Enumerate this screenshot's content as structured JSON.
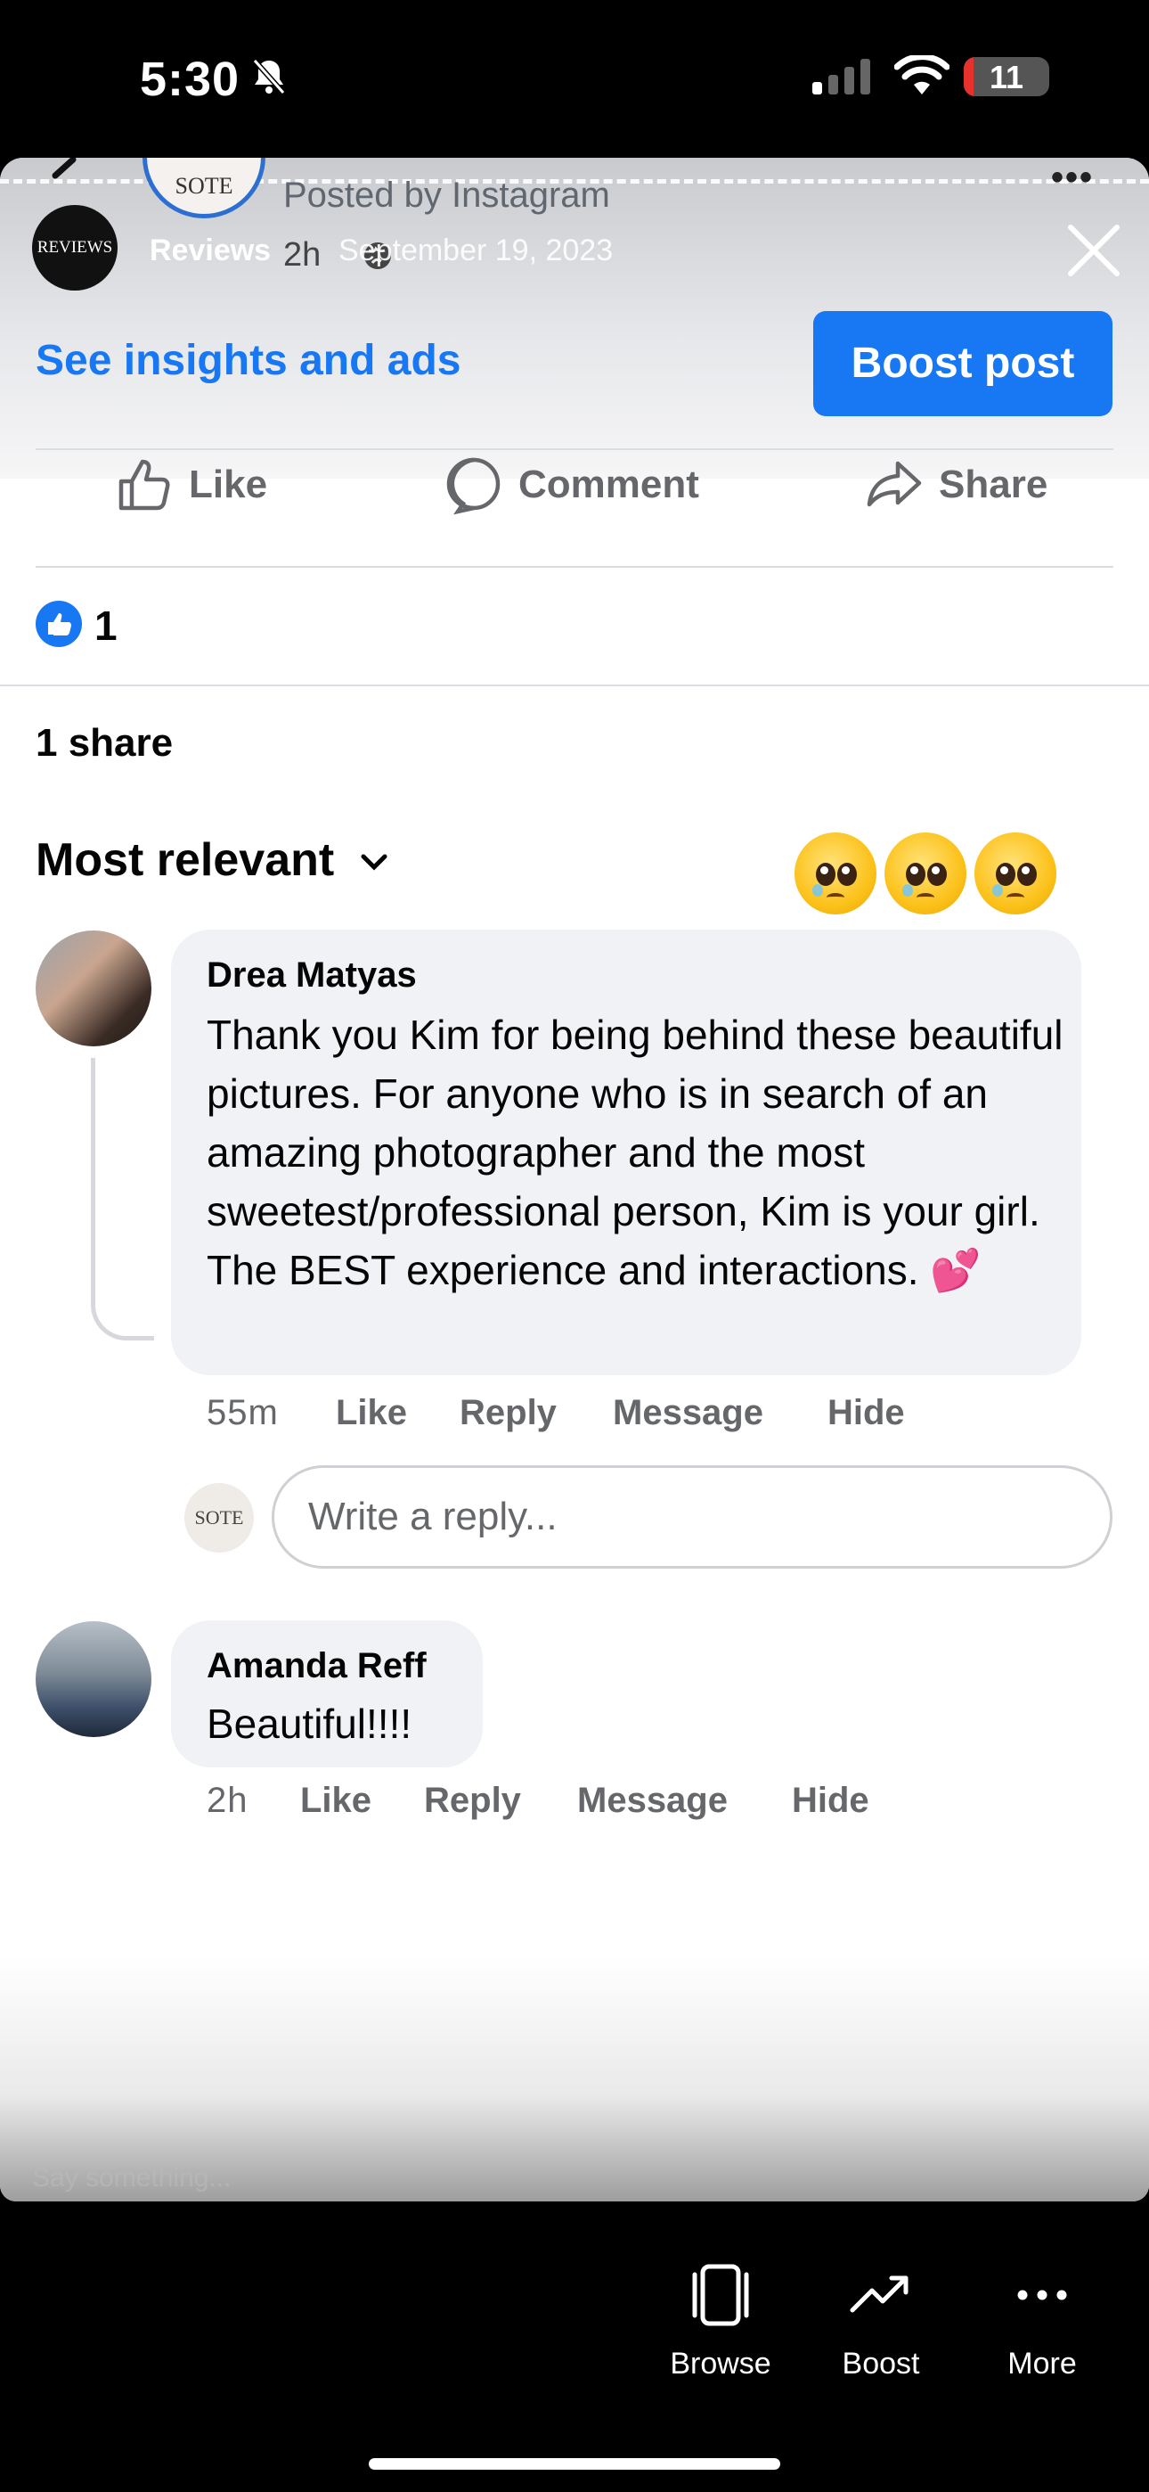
{
  "status_bar": {
    "time": "5:30",
    "battery": "11",
    "battery_percent": 11
  },
  "post_header": {
    "posted_by": "Posted by Instagram",
    "page_logo_text": "SOTE",
    "reviews_logo_text": "REVIEWS",
    "reviews_title": "Reviews",
    "date": "September 19, 2023",
    "time_ago": "2h"
  },
  "actions_bar": {
    "insights_link": "See insights and ads",
    "boost_button": "Boost post"
  },
  "engagement": {
    "like_label": "Like",
    "comment_label": "Comment",
    "share_label": "Share",
    "reaction_count": "1",
    "share_count": "1 share"
  },
  "sort": {
    "label": "Most relevant"
  },
  "comments": [
    {
      "name": "Drea Matyas",
      "text": "Thank you Kim for being behind these beautiful pictures. For anyone who is in search of an amazing photographer and the most sweetest/professional person, Kim is your girl. The BEST experience and interactions. 💕",
      "time": "55m",
      "like": "Like",
      "reply": "Reply",
      "message": "Message",
      "hide": "Hide"
    },
    {
      "name": "Amanda Reff",
      "text": "Beautiful!!!!",
      "time": "2h",
      "like": "Like",
      "reply": "Reply",
      "message": "Message",
      "hide": "Hide"
    }
  ],
  "reply_box": {
    "placeholder": "Write a reply...",
    "avatar_text": "SOTE"
  },
  "ghost_text": "Say something...",
  "bottom_bar": {
    "browse": "Browse",
    "boost": "Boost",
    "more": "More"
  },
  "colors": {
    "accent": "#1877f2",
    "bubble": "#f0f2f5",
    "secondary_text": "#65676b"
  },
  "icons": [
    "bell-slash-icon",
    "signal-icon",
    "wifi-icon",
    "battery-icon",
    "back-arrow-icon",
    "more-icon",
    "globe-icon",
    "close-icon",
    "like-icon",
    "comment-icon",
    "share-icon",
    "thumbs-up-reaction-icon",
    "chevron-down-icon",
    "pleading-face-emoji",
    "browse-icon",
    "boost-icon",
    "more-dots-icon"
  ]
}
